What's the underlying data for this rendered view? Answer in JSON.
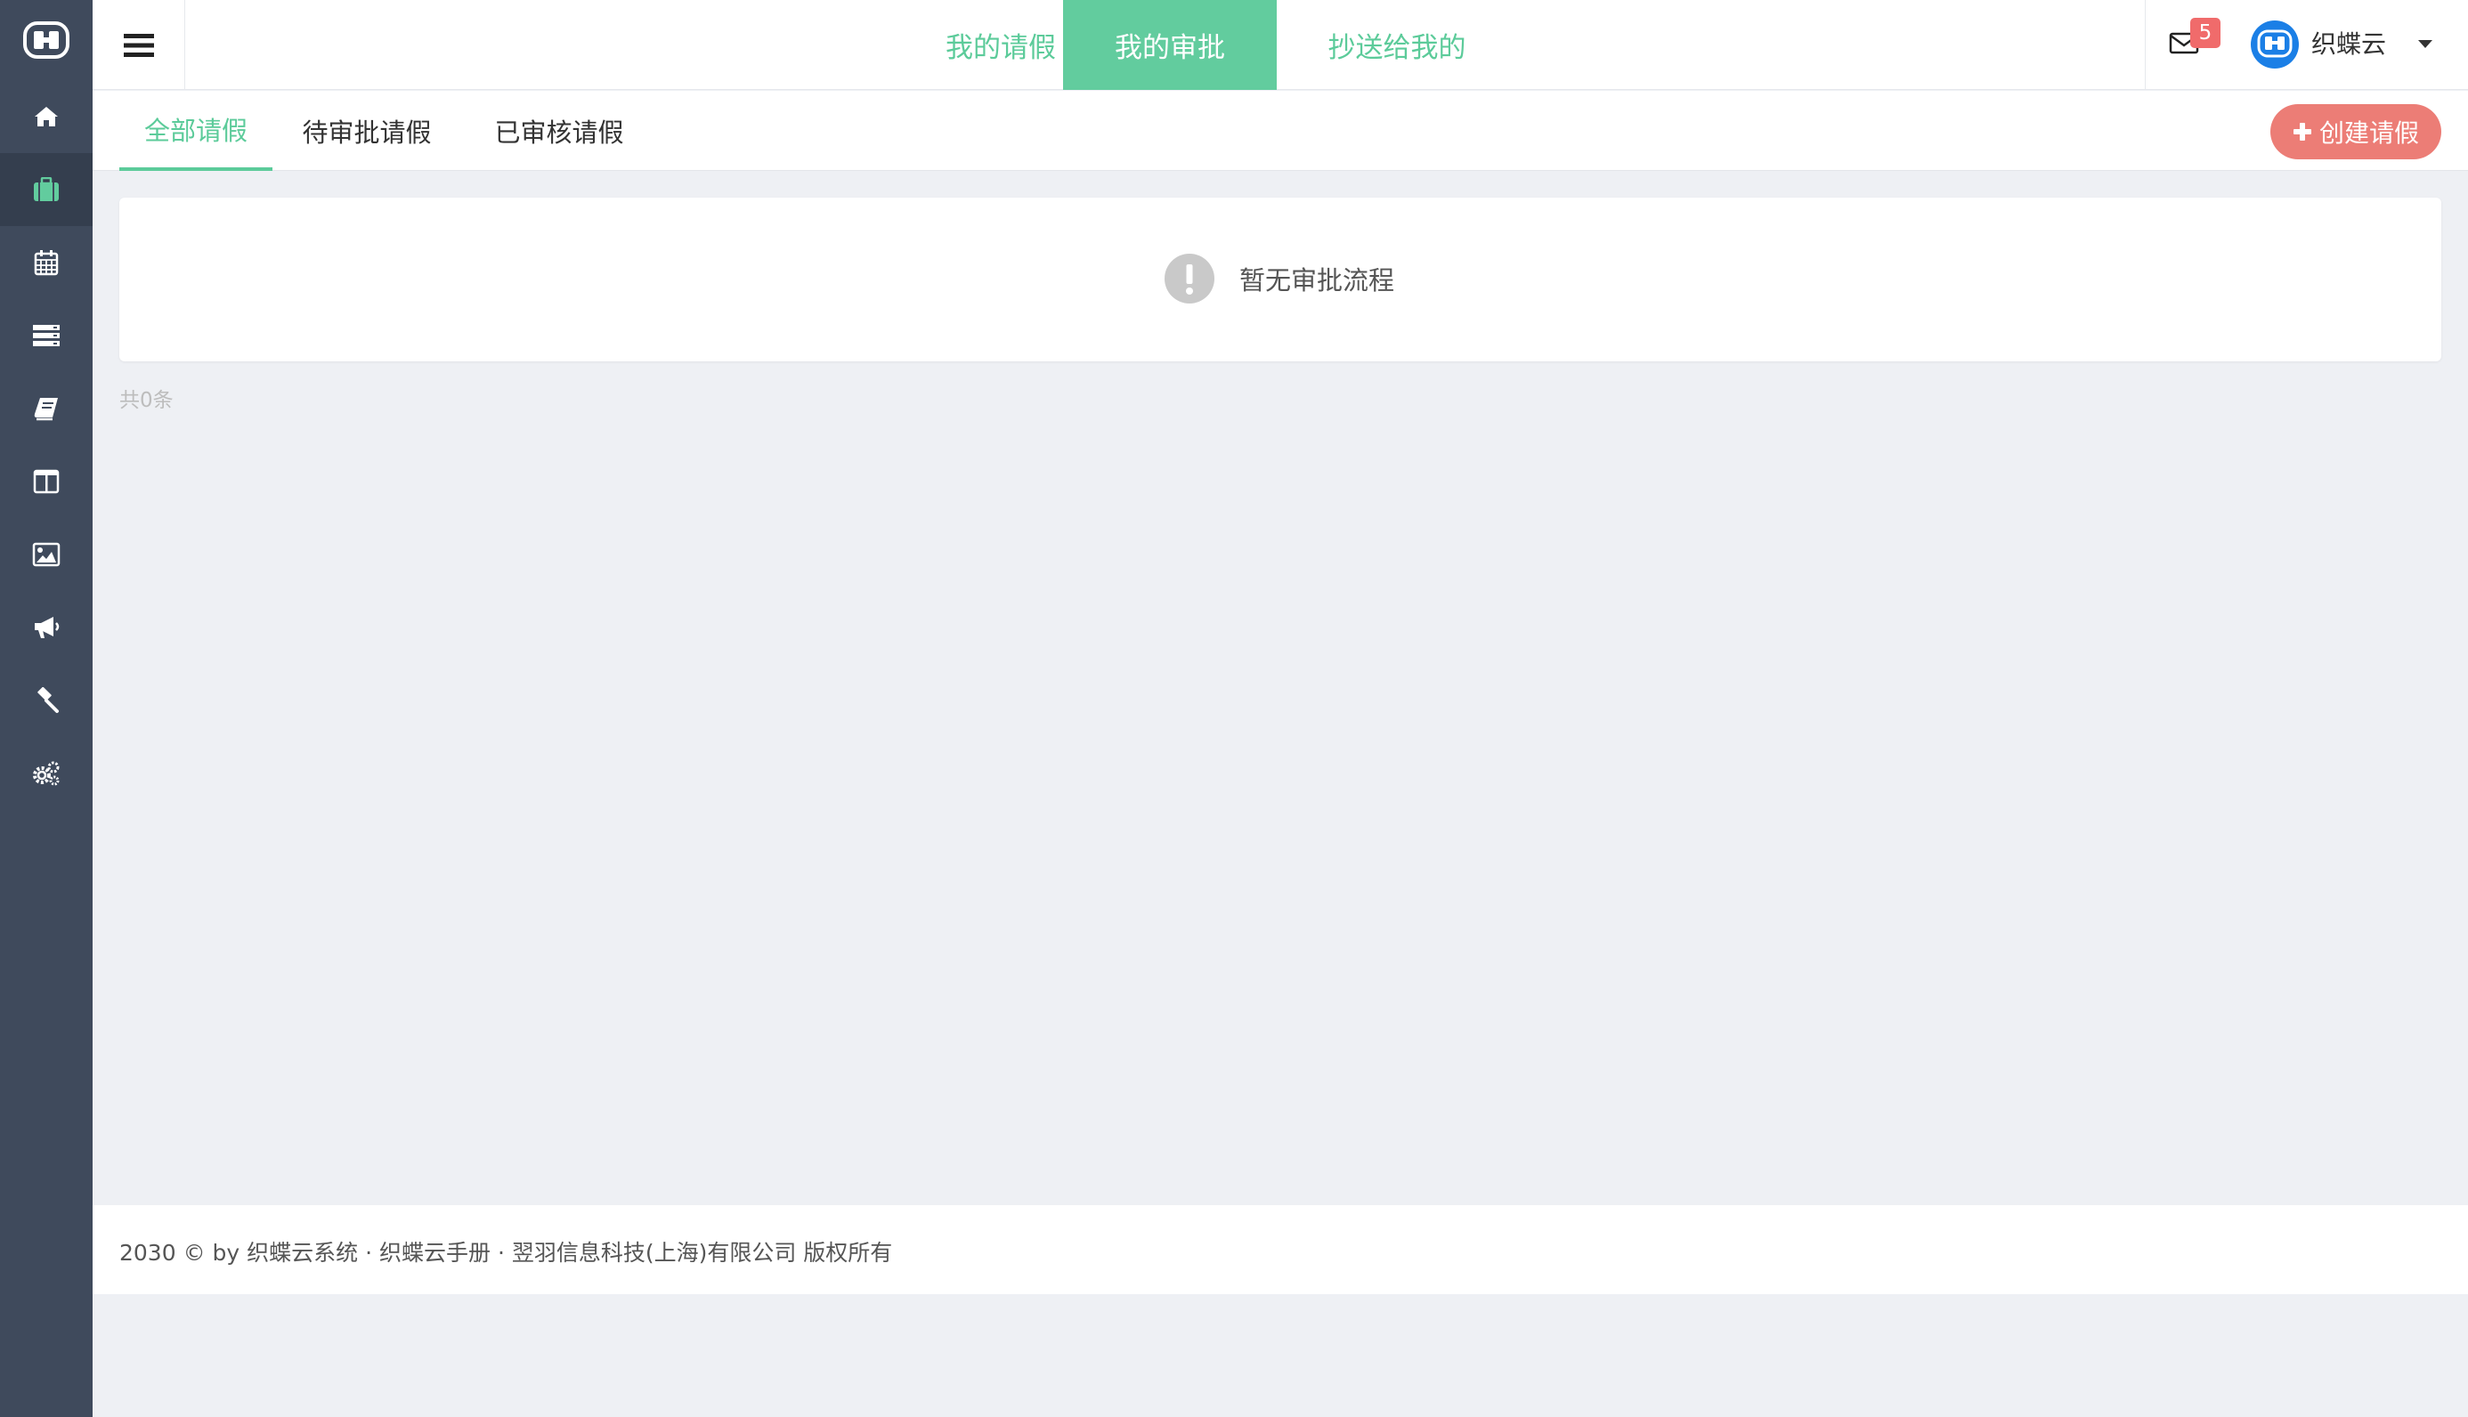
{
  "sidebar": {
    "logo": "logo-icon",
    "items": [
      {
        "icon": "home-icon",
        "active": false
      },
      {
        "icon": "briefcase-icon",
        "active": true
      },
      {
        "icon": "calendar-icon",
        "active": false
      },
      {
        "icon": "server-icon",
        "active": false
      },
      {
        "icon": "book-icon",
        "active": false
      },
      {
        "icon": "columns-icon",
        "active": false
      },
      {
        "icon": "image-icon",
        "active": false
      },
      {
        "icon": "megaphone-icon",
        "active": false
      },
      {
        "icon": "gavel-icon",
        "active": false
      },
      {
        "icon": "gears-icon",
        "active": false
      }
    ]
  },
  "header": {
    "tabs": [
      {
        "label": "我的请假",
        "active": false
      },
      {
        "label": "我的审批",
        "active": true
      },
      {
        "label": "抄送给我的",
        "active": false
      }
    ],
    "mail_badge": "5",
    "username": "织蝶云"
  },
  "subtabs": [
    {
      "label": "全部请假",
      "active": true
    },
    {
      "label": "待审批请假",
      "active": false
    },
    {
      "label": "已审核请假",
      "active": false
    }
  ],
  "create_button": "创建请假",
  "empty": {
    "message": "暂无审批流程"
  },
  "total_label": "共0条",
  "footer": {
    "copyright": "2030 © by 织蝶云系统",
    "sep1": " · ",
    "manual_link": "织蝶云手册",
    "sep2": " · ",
    "company": "翌羽信息科技(上海)有限公司 版权所有"
  },
  "colors": {
    "sidebar_bg": "#3f4a5c",
    "accent": "#62cc9e",
    "create_button": "#ec7d76",
    "badge": "#f06b6b",
    "avatar": "#1b7fe6"
  }
}
